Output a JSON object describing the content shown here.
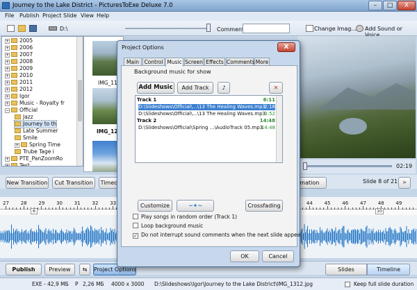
{
  "window": {
    "title": "Journey to the Lake District - PicturesToExe Deluxe 7.0",
    "min": "–",
    "max": "□",
    "close": "X"
  },
  "menu": [
    "File",
    "Publish",
    "Project",
    "Slide",
    "View",
    "Help"
  ],
  "toolbar": {
    "drive_label": "D:\\",
    "comment_label": "Comment",
    "change_image": "Change Imag...",
    "add_sound": "Add Sound or Voice"
  },
  "tree": {
    "items": [
      {
        "label": "2005",
        "expander": "+",
        "depth": 0
      },
      {
        "label": "2006",
        "expander": "+",
        "depth": 0
      },
      {
        "label": "2007",
        "expander": "+",
        "depth": 0
      },
      {
        "label": "2008",
        "expander": "+",
        "depth": 0
      },
      {
        "label": "2009",
        "expander": "+",
        "depth": 0
      },
      {
        "label": "2010",
        "expander": "+",
        "depth": 0
      },
      {
        "label": "2011",
        "expander": "+",
        "depth": 0
      },
      {
        "label": "2012",
        "expander": "+",
        "depth": 0
      },
      {
        "label": "Igor",
        "expander": "+",
        "depth": 0
      },
      {
        "label": "Music - Royalty fr",
        "expander": "+",
        "depth": 0
      },
      {
        "label": "Official",
        "expander": "−",
        "depth": 0
      },
      {
        "label": "Jazz",
        "expander": "",
        "depth": 1
      },
      {
        "label": "Journey to th",
        "expander": "",
        "depth": 1
      },
      {
        "label": "Late Summer",
        "expander": "",
        "depth": 1
      },
      {
        "label": "Smile",
        "expander": "",
        "depth": 1
      },
      {
        "label": "Spring Time",
        "expander": "+",
        "depth": 1
      },
      {
        "label": "Trube Tage i",
        "expander": "",
        "depth": 1
      },
      {
        "label": "PTE_PanZoomRo",
        "expander": "+",
        "depth": 0
      },
      {
        "label": "Test",
        "expander": "+",
        "depth": 0
      }
    ]
  },
  "thumbs": [
    {
      "label": "IMG_11"
    },
    {
      "label": "IMG_12"
    },
    {
      "label": ""
    }
  ],
  "preview": {
    "time": "02:19"
  },
  "transitions": {
    "new": "New Transition",
    "cut": "Cut Transition",
    "timed": "Timed",
    "animation": "nimation",
    "slide_count": "Slide 8 of 21"
  },
  "ruler": {
    "ticks": [
      "27",
      "28",
      "29",
      "30",
      "31",
      "32",
      "33",
      "34",
      "35",
      "36",
      "37",
      "38",
      "39",
      "40",
      "41",
      "42",
      "43",
      "44",
      "45",
      "46",
      "47",
      "48",
      "49"
    ],
    "marker_left": "6",
    "marker_right": "10"
  },
  "bottom": {
    "publish": "Publish",
    "preview": "Preview",
    "project_options": "Project Options",
    "slides": "Slides",
    "timeline": "Timeline"
  },
  "status": {
    "exe": "EXE - 42,9 МБ",
    "p": "P",
    "size": "2,26 МБ",
    "dims": "4000 x 3000",
    "path": "D:\\Slideshows\\Igor\\Journey to the Lake District\\IMG_1312.jpg",
    "keep": "Keep full slide duration"
  },
  "dialog": {
    "title": "Project Options",
    "tabs": [
      "Main",
      "Control",
      "Music",
      "Screen",
      "Effects",
      "Comments",
      "More"
    ],
    "active_tab": "Music",
    "section": "Background music for show",
    "add_music": "Add Music",
    "add_track": "Add Track",
    "tracks": [
      {
        "text": "Track 1",
        "time": "6:11",
        "kind": "head"
      },
      {
        "text": "D:\\Slideshows\\Official\\...\\13  The Healing Waves.mp3",
        "time": "2:18",
        "kind": "sel"
      },
      {
        "text": "D:\\Slideshows\\Official\\...\\13  The Healing Waves.mp3",
        "time": "3:52",
        "kind": "item"
      },
      {
        "text": "Track 2",
        "time": "14:48",
        "kind": "head"
      },
      {
        "text": "D:\\Slideshows\\Official\\Spring ...\\AudioTrack 05.mp3",
        "time": "14:48",
        "kind": "item"
      }
    ],
    "customize": "Customize",
    "crossfading": "Crossfading",
    "options": [
      {
        "label": "Play songs in random order (Track 1)",
        "checked": false
      },
      {
        "label": "Loop background music",
        "checked": false
      },
      {
        "label": "Do not interrupt sound comments when the next slide appea",
        "checked": true
      }
    ],
    "ok": "OK",
    "cancel": "Cancel",
    "close": "X"
  },
  "colors": {
    "accent": "#3a7fd0",
    "time_green": "#2e8b2e",
    "wave": "#1f73c4"
  }
}
